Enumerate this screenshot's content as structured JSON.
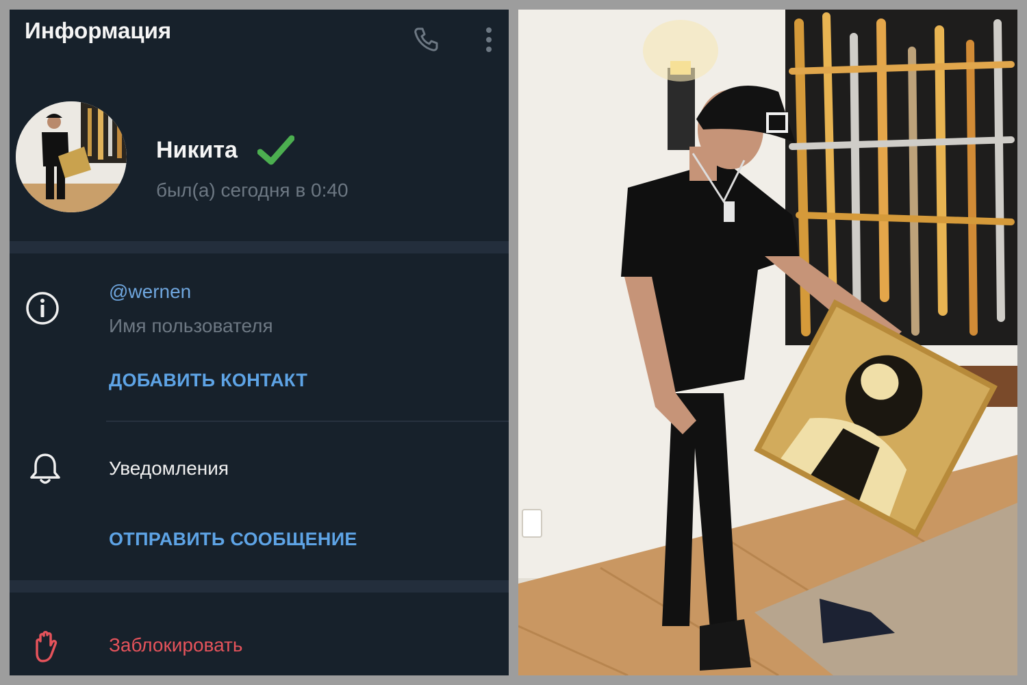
{
  "header": {
    "title": "Информация",
    "phone_icon": "phone-icon",
    "more_icon": "more-vertical-icon"
  },
  "profile": {
    "name": "Никита",
    "status": "был(а) сегодня в 0:40",
    "verified_icon": "checkmark-icon",
    "verified_color": "#4caf50"
  },
  "info": {
    "username": "@wernen",
    "username_label": "Имя пользователя",
    "add_contact": "ДОБАВИТЬ КОНТАКТ",
    "icon": "info-icon"
  },
  "notifications": {
    "label": "Уведомления",
    "send_message": "ОТПРАВИТЬ СООБЩЕНИЕ",
    "icon": "bell-icon"
  },
  "block": {
    "label": "Заблокировать",
    "icon": "hand-stop-icon",
    "color": "#e5535b"
  },
  "colors": {
    "panel_bg": "#17212b",
    "separator": "#232e3c",
    "link": "#5ea4e6",
    "muted": "#6d7883"
  }
}
